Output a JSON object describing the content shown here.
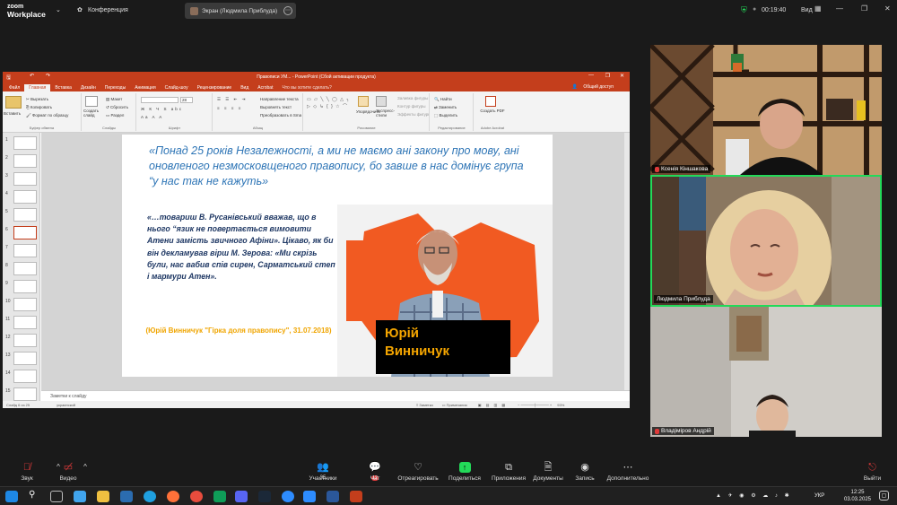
{
  "zoom": {
    "logo_line1": "zoom",
    "logo_line2": "Workplace",
    "meeting_label": "Конференция",
    "share_tab": "Экран (Людмила Приблуда)",
    "timer": "00:19:40",
    "view_label": "Вид"
  },
  "ppt": {
    "title": "Правописи УМ... - PowerPoint (Сбой активации продукта)",
    "tabs": [
      "Файл",
      "Главная",
      "Вставка",
      "Дизайн",
      "Переходы",
      "Анимация",
      "Слайд-шоу",
      "Рецензирование",
      "Вид",
      "Acrobat"
    ],
    "active_tab": "Главная",
    "tell_me": "Что вы хотите сделать?",
    "share": "Общий доступ",
    "ribbon": {
      "paste": "Вставить",
      "cut": "Вырезать",
      "copy": "Копировать",
      "format": "Формат по образцу",
      "clipboard": "Буфер обмена",
      "new_slide": "Создать слайд",
      "layout": "Макет",
      "reset": "Сбросить",
      "section": "Раздел",
      "slides": "Слайды",
      "font": "Шрифт",
      "font_size": "28",
      "text_direction": "Направление текста",
      "align_text": "Выровнять текст",
      "smartart": "Преобразовать в SmartArt",
      "paragraph": "Абзац",
      "arrange": "Упорядочить",
      "quick_styles": "Экспресс-стили",
      "fill": "Заливка фигуры",
      "outline": "Контур фигуры",
      "effects": "Эффекты фигуры",
      "drawing": "Рисование",
      "find": "Найти",
      "replace": "Заменить",
      "select": "Выделить",
      "editing": "Редактирование",
      "create_pdf": "Создать PDF",
      "acrobat": "Adobe Acrobat"
    },
    "slide_numbers": [
      "1",
      "2",
      "3",
      "4",
      "5",
      "6",
      "7",
      "8",
      "9",
      "10",
      "11",
      "12",
      "13",
      "14",
      "15"
    ],
    "selected_slide": "6",
    "slide": {
      "heading": "«Понад 25 років Незалежності, а ми не маємо ані закону про мову, ані оновленого незмосковщеного правопису, бо завше в нас домінує група “у нас так не кажуть»",
      "quote": "«…товариш В. Русанівський вважав, що в нього “язик не повертається вимовити Атени замість звичного Афіни». Цікаво, як би він декламував вірш М. Зерова: «Ми скрізь були, нас вабив спів сирен, Сарматський степ і мармури Атен».",
      "cite": "(Юрій Винничук \"Гірка доля правопису\", 31.07.2018)",
      "name_line1": "Юрій",
      "name_line2": "Винничук"
    },
    "notes_placeholder": "Заметки к слайду",
    "status_slide": "Слайд 6 из 25",
    "status_lang": "украинский",
    "status_notes": "Заметки",
    "status_comments": "Примечания",
    "zoom_level": "93%"
  },
  "participants": [
    {
      "name": "Ксенія Кіншакова"
    },
    {
      "name": "Людмила Приблуда"
    },
    {
      "name": "Владіміров Андрій"
    }
  ],
  "toolbar": {
    "audio": "Звук",
    "video": "Видео",
    "participants": "Участники",
    "participants_count": "35",
    "chat": "Чат",
    "chat_badge": "12",
    "react": "Отреагировать",
    "share": "Поделиться",
    "apps": "Приложения",
    "docs": "Документы",
    "record": "Запись",
    "more": "Дополнительно",
    "leave": "Выйти"
  },
  "taskbar": {
    "time": "12:25",
    "date": "03.03.2025",
    "lang": "УКР"
  },
  "colors": {
    "ppt_accent": "#c43e1c",
    "zoom_green": "#23d959",
    "heading_blue": "#2e75b6",
    "quote_navy": "#1f3864",
    "cite_gold": "#f0a500"
  }
}
